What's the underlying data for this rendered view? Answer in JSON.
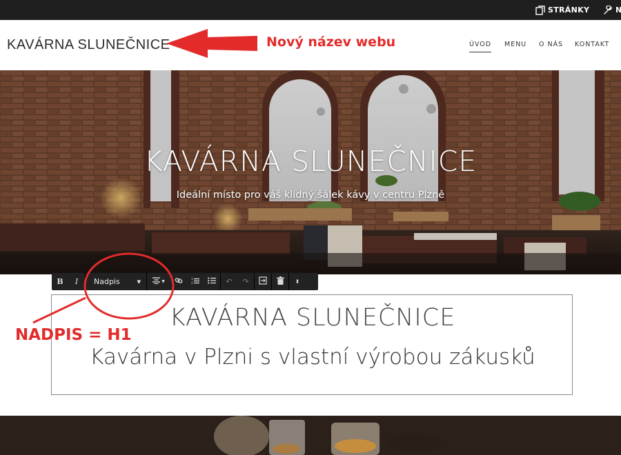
{
  "editor_bar": {
    "pages_label": "STRÁNKY",
    "more_label": "N",
    "pages_icon": "pages-icon",
    "wrench_icon": "wrench-icon"
  },
  "site": {
    "title": "KAVÁRNA SLUNEČNICE",
    "nav": [
      "ÚVOD",
      "MENU",
      "O NÁS",
      "KONTAKT"
    ],
    "active_nav": "ÚVOD"
  },
  "hero": {
    "title": "KAVÁRNA SLUNEČNICE",
    "subtitle": "Ideální místo pro váš klidný šálek kávy v centru Plzně"
  },
  "format_toolbar": {
    "bold": "B",
    "italic": "I",
    "style_select": "Nadpis",
    "icons": [
      "bold-icon",
      "italic-icon",
      "align-center-icon",
      "link-icon",
      "ordered-list-icon",
      "bullet-list-icon",
      "undo-icon",
      "redo-icon",
      "fit-icon",
      "trash-icon",
      "more-icon"
    ]
  },
  "content": {
    "heading": "KAVÁRNA SLUNEČNICE",
    "subheading": "Kavárna v Plzni s vlastní výrobou zákusků"
  },
  "annotations": {
    "new_name": "Nový název webu",
    "heading_level": "NADPIS = H1",
    "color": "#e32b2b"
  }
}
